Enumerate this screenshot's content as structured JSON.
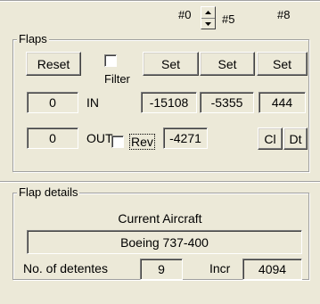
{
  "header": {
    "col0": "#0",
    "col5": "#5",
    "col8": "#8"
  },
  "flaps": {
    "legend": "Flaps",
    "reset_label": "Reset",
    "filter_label": "Filter",
    "set_labels": [
      "Set",
      "Set",
      "Set"
    ],
    "in_label": "IN",
    "out_label": "OUT",
    "rev_label": "Rev",
    "in_value": "0",
    "out_value": "0",
    "in_values": [
      "-15108",
      "-5355",
      "444"
    ],
    "out_value_2": "-4271",
    "cl_label": "Cl",
    "dt_label": "Dt",
    "filter_checked": false,
    "rev_checked": false
  },
  "details": {
    "legend": "Flap details",
    "current_aircraft_label": "Current Aircraft",
    "aircraft_name": "Boeing 737-400",
    "detentes_label": "No. of detentes",
    "detentes_value": "9",
    "incr_label": "Incr",
    "incr_value": "4094"
  }
}
